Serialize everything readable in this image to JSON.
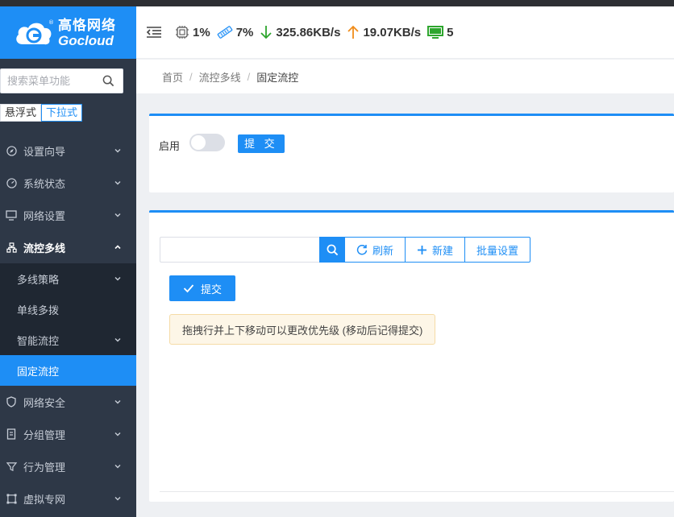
{
  "brand": {
    "name_cn": "高恪网络",
    "name_en": "Gocloud",
    "brand_color": "#1e8ef5"
  },
  "sidebar": {
    "search_placeholder": "搜索菜单功能",
    "modes": [
      "悬浮式",
      "下拉式"
    ],
    "menu": [
      {
        "label": "设置向导",
        "icon": "compass-icon"
      },
      {
        "label": "系统状态",
        "icon": "gauge-icon"
      },
      {
        "label": "网络设置",
        "icon": "monitor-icon"
      },
      {
        "label": "流控多线",
        "icon": "network-icon",
        "open": true
      },
      {
        "label": "网络安全",
        "icon": "shield-icon"
      },
      {
        "label": "分组管理",
        "icon": "document-icon"
      },
      {
        "label": "行为管理",
        "icon": "funnel-icon"
      },
      {
        "label": "虚拟专网",
        "icon": "vpn-icon"
      }
    ],
    "submenu": [
      {
        "label": "多线策略",
        "expandable": true
      },
      {
        "label": "单线多拨",
        "expandable": false
      },
      {
        "label": "智能流控",
        "expandable": true
      },
      {
        "label": "固定流控",
        "active": true
      }
    ]
  },
  "header": {
    "cpu": "1%",
    "memory": "7%",
    "download": "325.86KB/s",
    "upload": "19.07KB/s",
    "clients": "5"
  },
  "breadcrumb": [
    "首页",
    "流控多线",
    "固定流控"
  ],
  "card1": {
    "enable_label": "启用",
    "enabled": false,
    "submit_label": "提 交"
  },
  "card2": {
    "search_value": "",
    "refresh_label": "刷新",
    "new_label": "新建",
    "batch_label": "批量设置",
    "submit_label": "提交",
    "tip": "拖拽行并上下移动可以更改优先级 (移动后记得提交)"
  }
}
